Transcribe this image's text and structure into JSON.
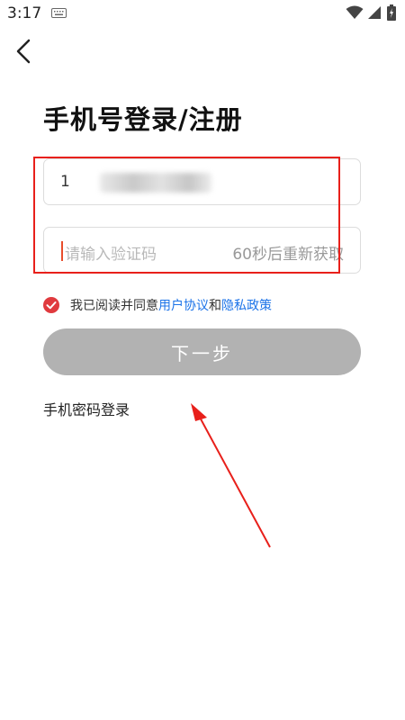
{
  "status_bar": {
    "time": "3:17"
  },
  "title": "手机号登录/注册",
  "phone": {
    "visible_prefix": "1"
  },
  "code": {
    "placeholder": "请输入验证码",
    "resend": "60秒后重新获取"
  },
  "agreement": {
    "prefix": "我已阅读并同意",
    "user_agreement": "用户协议",
    "and": "和",
    "privacy_policy": "隐私政策",
    "checked": true
  },
  "next_button": "下一步",
  "password_login": "手机密码登录",
  "colors": {
    "accent_red": "#e8201b",
    "link_blue": "#1c73e8",
    "button_disabled": "#b2b2b2",
    "check_red": "#e03a3e"
  }
}
